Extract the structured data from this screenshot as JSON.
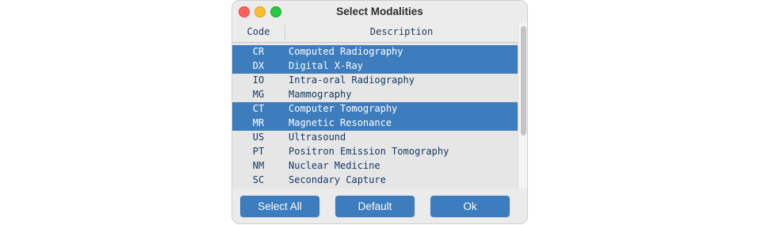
{
  "window": {
    "title": "Select Modalities"
  },
  "table": {
    "columns": {
      "code": "Code",
      "description": "Description"
    },
    "rows": [
      {
        "code": "CR",
        "description": "Computed Radiography",
        "selected": true
      },
      {
        "code": "DX",
        "description": "Digital X-Ray",
        "selected": true
      },
      {
        "code": "IO",
        "description": "Intra-oral Radiography",
        "selected": false
      },
      {
        "code": "MG",
        "description": "Mammography",
        "selected": false
      },
      {
        "code": "CT",
        "description": "Computer Tomography",
        "selected": true
      },
      {
        "code": "MR",
        "description": "Magnetic Resonance",
        "selected": true
      },
      {
        "code": "US",
        "description": "Ultrasound",
        "selected": false
      },
      {
        "code": "PT",
        "description": "Positron Emission Tomography",
        "selected": false
      },
      {
        "code": "NM",
        "description": "Nuclear Medicine",
        "selected": false
      },
      {
        "code": "SC",
        "description": "Secondary Capture",
        "selected": false
      }
    ]
  },
  "buttons": {
    "select_all": "Select All",
    "default": "Default",
    "ok": "Ok"
  },
  "colors": {
    "selection": "#3d7dbd",
    "button": "#3d7dbd",
    "text": "#143a63"
  }
}
